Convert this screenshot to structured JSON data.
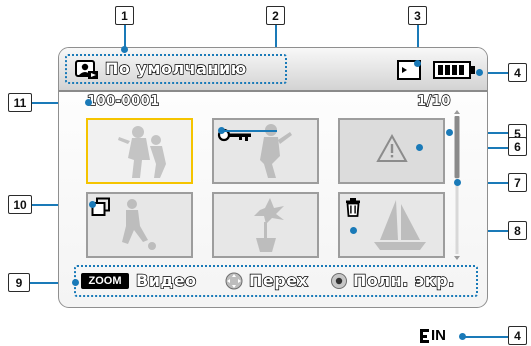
{
  "callouts": {
    "c1": "1",
    "c2": "2",
    "c3": "3",
    "c4": "4",
    "c5": "5",
    "c6": "6",
    "c7": "7",
    "c8": "8",
    "c9": "9",
    "c10": "10",
    "c11": "11",
    "c4b": "4"
  },
  "header": {
    "mode_title": "По умолчанию"
  },
  "info": {
    "file_number": "100-0001",
    "page_counter": "1/10"
  },
  "footer": {
    "zoom_label": "ZOOM",
    "video_label": "Видео",
    "move_label": "Перех",
    "full_label": "Полн. экр."
  },
  "bottom_indicator": {
    "label": "IN"
  },
  "colors": {
    "leader": "#1a7ab8",
    "selection": "#f5c400",
    "thumb_bg": "#e7e7e7",
    "figure": "#b9b9b9"
  },
  "icons": [
    "photo-mode-icon",
    "protect-key-icon",
    "memory-card-icon",
    "battery-icon",
    "warning-icon",
    "copy-icon",
    "trash-icon",
    "dpad-icon",
    "ok-button-icon",
    "internal-memory-icon"
  ],
  "scroll": {
    "position_fraction": 0.0
  }
}
